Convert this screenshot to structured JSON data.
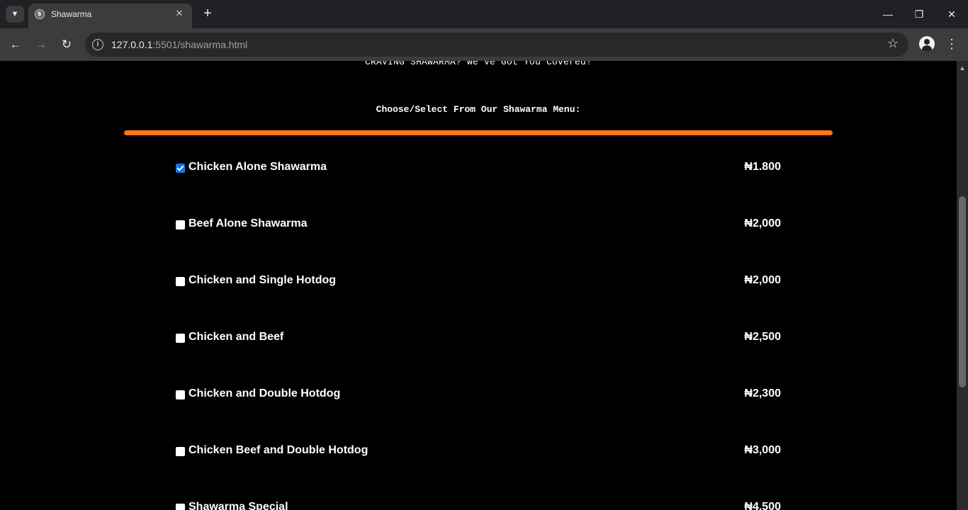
{
  "browser": {
    "tab_list_icon": "chevron-down",
    "tab_title": "Shawarma",
    "tab_close": "✕",
    "new_tab": "+",
    "window": {
      "minimize": "—",
      "restore": "❐",
      "close": "✕"
    },
    "url_host": "127.0.0.1",
    "url_rest": ":5501/shawarma.html",
    "back": "←",
    "forward": "→",
    "reload": "↻",
    "star": "☆",
    "menu": "⋮"
  },
  "page": {
    "tagline": "CRAVING SHAWARMA? We've Got You Covered!",
    "menu_heading": "Choose/Select From Our Shawarma Menu:",
    "accent_color": "#ff7518",
    "items": [
      {
        "name": "Chicken Alone Shawarma",
        "price": "₦1.800",
        "checked": true
      },
      {
        "name": "Beef Alone Shawarma",
        "price": "₦2,000",
        "checked": false
      },
      {
        "name": "Chicken and Single Hotdog",
        "price": "₦2,000",
        "checked": false
      },
      {
        "name": "Chicken and Beef",
        "price": "₦2,500",
        "checked": false
      },
      {
        "name": "Chicken and Double Hotdog",
        "price": "₦2,300",
        "checked": false
      },
      {
        "name": "Chicken Beef and Double Hotdog",
        "price": "₦3,000",
        "checked": false
      },
      {
        "name": "Shawarma Special",
        "price": "₦4,500",
        "checked": false
      }
    ]
  }
}
